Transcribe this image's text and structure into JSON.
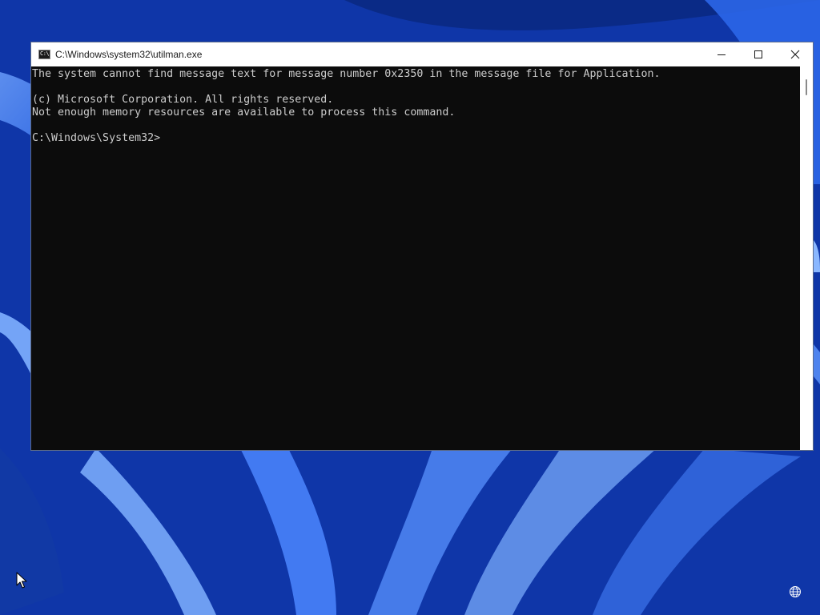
{
  "window": {
    "title": "C:\\Windows\\system32\\utilman.exe",
    "icon_text": "C:\\",
    "icons": {
      "app": "cmd-icon",
      "minimize": "minimize-icon",
      "maximize": "maximize-icon",
      "close": "close-icon"
    }
  },
  "console": {
    "lines": [
      "The system cannot find message text for message number 0x2350 in the message file for Application.",
      "",
      "(c) Microsoft Corporation. All rights reserved.",
      "Not enough memory resources are available to process this command.",
      "",
      "C:\\Windows\\System32>"
    ]
  },
  "desktop": {
    "icons": {
      "cursor": "mouse-pointer-icon",
      "tray": "globe-icon"
    }
  },
  "colors": {
    "console_bg": "#0c0c0c",
    "console_text": "#cccccc",
    "wallpaper": "#1440b8"
  }
}
